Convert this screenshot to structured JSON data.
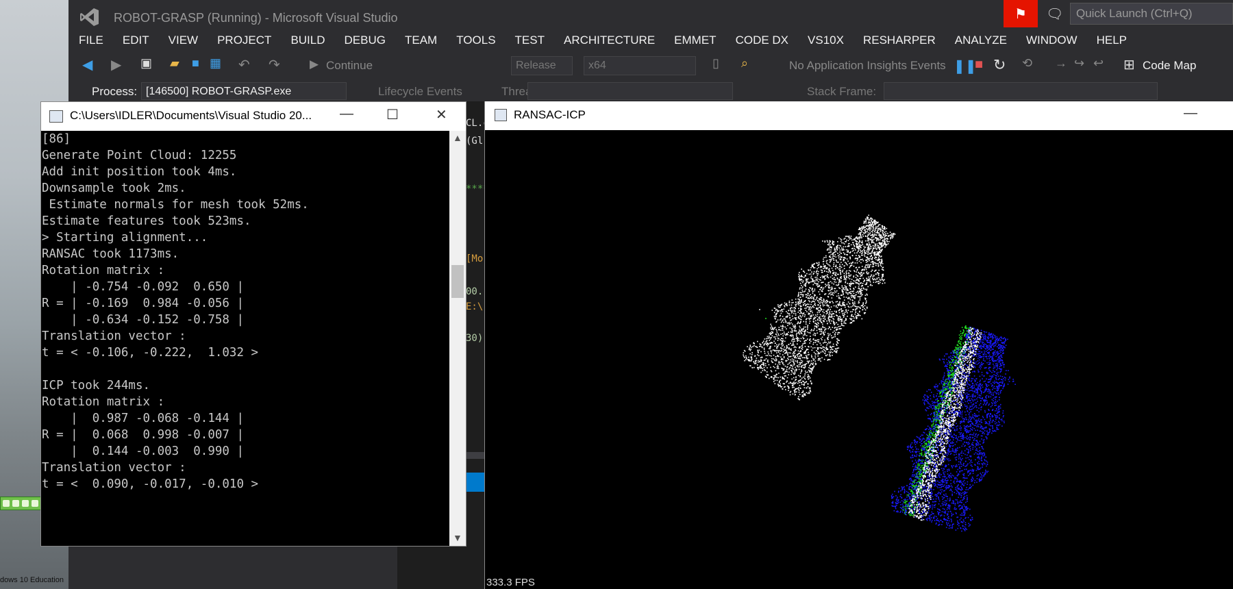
{
  "desktop": {
    "edition_text": "dows 10 Education"
  },
  "vs": {
    "title": "ROBOT-GRASP (Running) - Microsoft Visual Studio",
    "quick_launch_placeholder": "Quick Launch (Ctrl+Q)",
    "menu": [
      "FILE",
      "EDIT",
      "VIEW",
      "PROJECT",
      "BUILD",
      "DEBUG",
      "TEAM",
      "TOOLS",
      "TEST",
      "ARCHITECTURE",
      "EMMET",
      "CODE DX",
      "VS10X",
      "RESHARPER",
      "ANALYZE",
      "WINDOW",
      "HELP"
    ],
    "toolbar": {
      "continue_label": "Continue",
      "config": "Release",
      "platform": "x64",
      "insights": "No Application Insights Events",
      "code_map": "Code Map"
    },
    "debugbar": {
      "process_label": "Process:",
      "process_value": "[146500] ROBOT-GRASP.exe",
      "lifecycle_label": "Lifecycle Events",
      "thread_label": "Thread:",
      "stack_label": "Stack Frame:"
    },
    "editor_fragments": [
      "CL.c",
      "(Gl",
      "[Mo",
      "00.",
      "E:\\",
      "30)"
    ]
  },
  "console": {
    "title": "C:\\Users\\IDLER\\Documents\\Visual Studio 20...",
    "lines": [
      "[86]",
      "Generate Point Cloud: 12255",
      "Add init position took 4ms.",
      "Downsample took 2ms.",
      " Estimate normals for mesh took 52ms.",
      "Estimate features took 523ms.",
      "> Starting alignment...",
      "RANSAC took 1173ms.",
      "Rotation matrix :",
      "    | -0.754 -0.092  0.650 |",
      "R = | -0.169  0.984 -0.056 |",
      "    | -0.634 -0.152 -0.758 |",
      "Translation vector :",
      "t = < -0.106, -0.222,  1.032 >",
      "",
      "ICP took 244ms.",
      "Rotation matrix :",
      "    |  0.987 -0.068 -0.144 |",
      "R = |  0.068  0.998 -0.007 |",
      "    |  0.144 -0.003  0.990 |",
      "Translation vector :",
      "t = <  0.090, -0.017, -0.010 >"
    ]
  },
  "viewer": {
    "title": "RANSAC-ICP",
    "fps": "333.3 FPS"
  },
  "colors": {
    "vs_bg": "#2d2d30",
    "accent_blue": "#007acc",
    "flag_red": "#e51400",
    "cloud_white": "#ffffff",
    "cloud_green": "#22dd22",
    "cloud_blue": "#1a1aff"
  }
}
